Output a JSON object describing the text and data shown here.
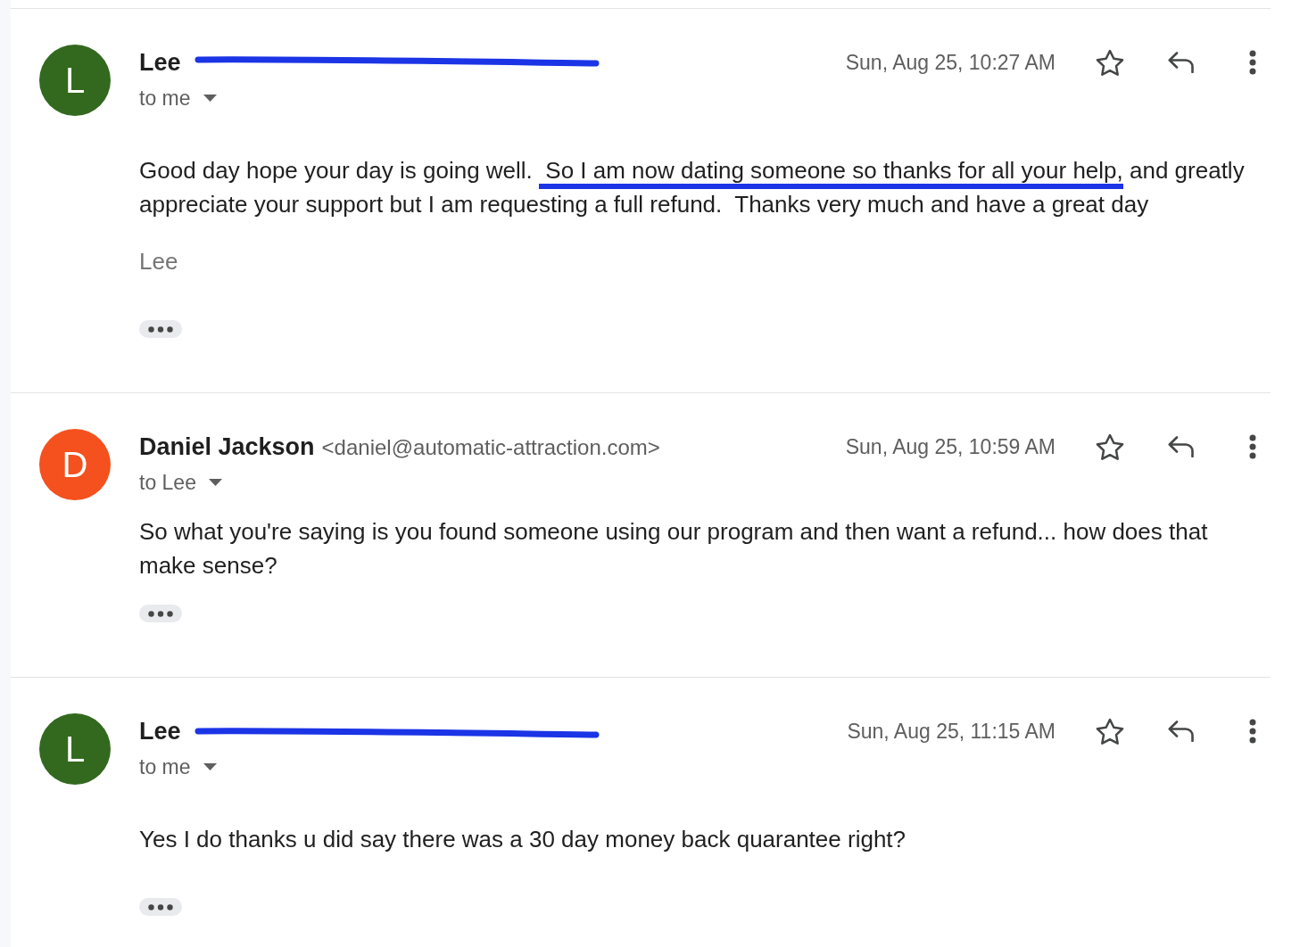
{
  "messages": [
    {
      "avatar": {
        "letter": "L",
        "color": "#33691e"
      },
      "sender": {
        "name": "Lee",
        "redacted": true
      },
      "recipient": "to me",
      "date": "Sun, Aug 25, 10:27 AM",
      "starred": false,
      "body": [
        {
          "text": "Good day hope your day is going well. ",
          "underlined": false
        },
        {
          "text": " So I am now dating someone so thanks for all your help,",
          "underlined": true
        },
        {
          "text": " and greatly appreciate your support but I am requesting a full refund.  Thanks very much and have a great day",
          "underlined": false
        }
      ],
      "signature": "Lee"
    },
    {
      "avatar": {
        "letter": "D",
        "color": "#f4511e"
      },
      "sender": {
        "name": "Daniel Jackson",
        "email": "<daniel@automatic-attraction.com>",
        "redacted": false
      },
      "recipient": "to Lee",
      "date": "Sun, Aug 25, 10:59 AM",
      "starred": false,
      "body": [
        {
          "text": "So what you're saying is you found someone using our program and then want a refund... how does that make sense?",
          "underlined": false
        }
      ]
    },
    {
      "avatar": {
        "letter": "L",
        "color": "#33691e"
      },
      "sender": {
        "name": "Lee",
        "redacted": true
      },
      "recipient": "to me",
      "date": "Sun, Aug 25, 11:15 AM",
      "starred": false,
      "body": [
        {
          "text": "Yes I do thanks u did say there was a 30 day money back quarantee right?",
          "underlined": false
        }
      ]
    }
  ]
}
